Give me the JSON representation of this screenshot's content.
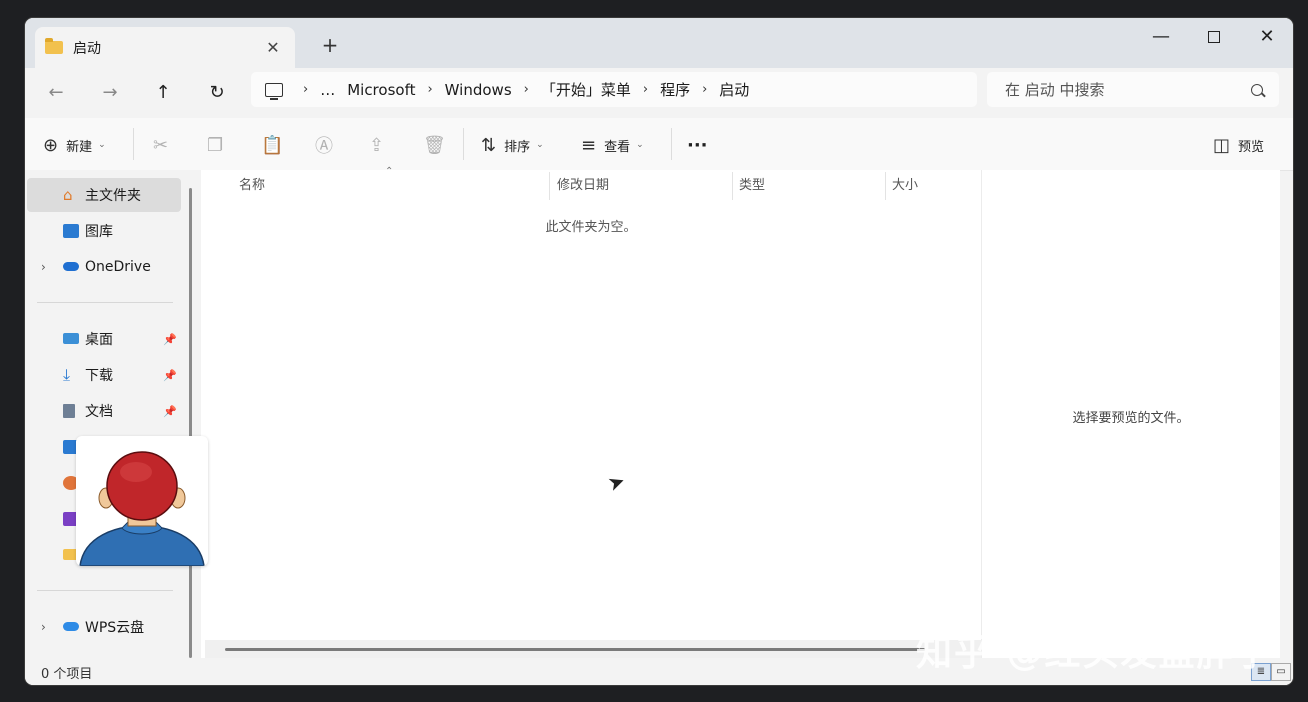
{
  "window": {
    "tab_title": "启动",
    "new_tab": "+",
    "close_tab": "✕",
    "minimize": "—",
    "close": "✕"
  },
  "address": {
    "crumbs": [
      "…",
      "Microsoft",
      "Windows",
      "「开始」菜单",
      "程序",
      "启动"
    ],
    "search_placeholder": "在 启动 中搜索"
  },
  "toolbar": {
    "new_label": "新建",
    "sort_label": "排序",
    "view_label": "查看",
    "more": "···",
    "preview_label": "预览"
  },
  "sidebar": {
    "home": "主文件夹",
    "gallery": "图库",
    "onedrive": "OneDrive",
    "desktop": "桌面",
    "downloads": "下载",
    "documents": "文档",
    "wps": "WPS云盘"
  },
  "content": {
    "columns": [
      "名称",
      "修改日期",
      "类型",
      "大小"
    ],
    "empty_message": "此文件夹为空。"
  },
  "preview": {
    "message": "选择要预览的文件。"
  },
  "status": {
    "item_count": "0 个项目"
  },
  "watermark": "知乎 @红头发蓝胖子",
  "colors": {
    "accent": "#0067c0",
    "folder": "#f2c14e",
    "avatar_hair": "#c0262a",
    "avatar_shirt": "#2f6fb3"
  }
}
